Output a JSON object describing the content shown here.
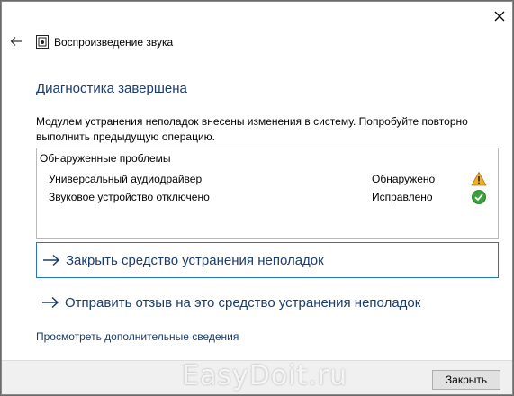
{
  "window": {
    "title": "Воспроизведение звука",
    "icon": "speaker-troubleshoot-icon",
    "close_glyph": "✕",
    "back_glyph": "←"
  },
  "main": {
    "heading": "Диагностика завершена",
    "message": "Модулем устранения неполадок внесены изменения в систему. Попробуйте повторно выполнить предыдущую операцию.",
    "problems": {
      "title": "Обнаруженные проблемы",
      "items": [
        {
          "name": "Универсальный аудиодрайвер",
          "status": "Обнаружено",
          "icon": "warning-icon"
        },
        {
          "name": "Звуковое устройство отключено",
          "status": "Исправлено",
          "icon": "fixed-check-icon"
        }
      ]
    },
    "actions": [
      {
        "label": "Закрыть средство устранения неполадок"
      },
      {
        "label": "Отправить отзыв на это средство устранения неполадок"
      }
    ],
    "more_link": "Просмотреть дополнительные сведения"
  },
  "footer": {
    "close_label": "Закрыть"
  },
  "watermark": "EasyDoit.ru",
  "colors": {
    "accent": "#2b73c7",
    "link_text": "#1a3c6e",
    "warning": "#f2b01e",
    "success": "#3aa13a"
  }
}
